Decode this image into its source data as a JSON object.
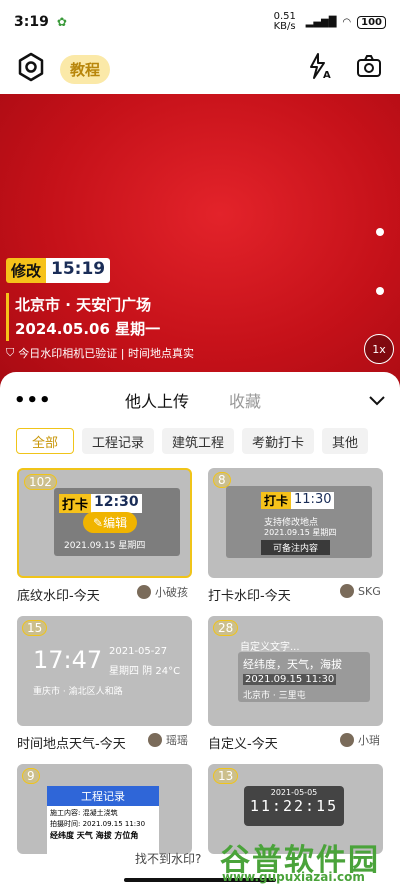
{
  "status": {
    "time": "3:19",
    "speed": "0.51 KB/s",
    "battery": "100"
  },
  "topbar": {
    "tutorial": "教程"
  },
  "watermark": {
    "tag": "修改",
    "time": "15:19",
    "location": "北京市 · 天安门广场",
    "date": "2024.05.06 星期一",
    "verified": "今日水印相机已验证 | 时间地点真实",
    "zoom": "1x"
  },
  "tabs": {
    "others": "他人上传",
    "favorites": "收藏"
  },
  "chips": [
    "全部",
    "工程记录",
    "建筑工程",
    "考勤打卡",
    "其他"
  ],
  "cards": [
    {
      "badge": "102",
      "title": "底纹水印-今天",
      "author": "小破孩",
      "tag": "打卡",
      "time": "12:30",
      "date": "2021.09.15 星期四",
      "edit": "编辑"
    },
    {
      "badge": "8",
      "title": "打卡水印-今天",
      "author": "SKG",
      "tag": "打卡",
      "time": "11:30",
      "line1": "支持修改地点",
      "line2": "2021.09.15 星期四",
      "note": "可备注内容"
    },
    {
      "badge": "15",
      "title": "时间地点天气-今天",
      "author": "瑶瑶",
      "time": "17:47",
      "date": "2021-05-27",
      "weather": "星期四 阴 24°C",
      "place": "重庆市 · 渝北区人和路"
    },
    {
      "badge": "28",
      "title": "自定义-今天",
      "author": "小琑",
      "custom": "自定义文字...",
      "info": "经纬度，天气，海拔",
      "datetime": "2021.09.15 11:30",
      "place": "北京市 · 三里屯"
    },
    {
      "badge": "9",
      "header": "工程记录",
      "r1": "施工内容: 混凝土浇筑",
      "r2": "拍摄时间: 2021.09.15 11:30",
      "r3": "经纬度  天气  海拔  方位角"
    },
    {
      "badge": "13",
      "date": "2021-05-05",
      "clock": "11:22:15"
    }
  ],
  "bottom": {
    "text": "找不到水印?"
  },
  "logo": {
    "cn": "谷普软件园",
    "url": "www.gupuxiazai.com"
  }
}
